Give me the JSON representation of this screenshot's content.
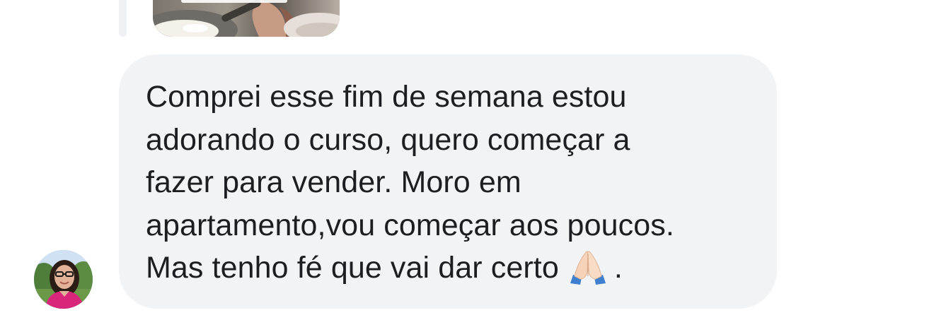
{
  "reply_preview": {
    "thumbnail_icon": "food-photo-thumbnail"
  },
  "comment": {
    "avatar_icon": "user-avatar",
    "text_before_emoji": "Comprei esse fim de semana estou\nadorando o curso, quero começar a\nfazer para vender. Moro em\napartamento,vou começar aos poucos.\nMas tenho fé que vai dar certo",
    "emoji_icon": "folded-hands-emoji",
    "text_after_emoji": "."
  },
  "colors": {
    "bubble_background": "#f2f3f5",
    "text": "#1c1e21",
    "reply_line": "#f0f1f3"
  }
}
